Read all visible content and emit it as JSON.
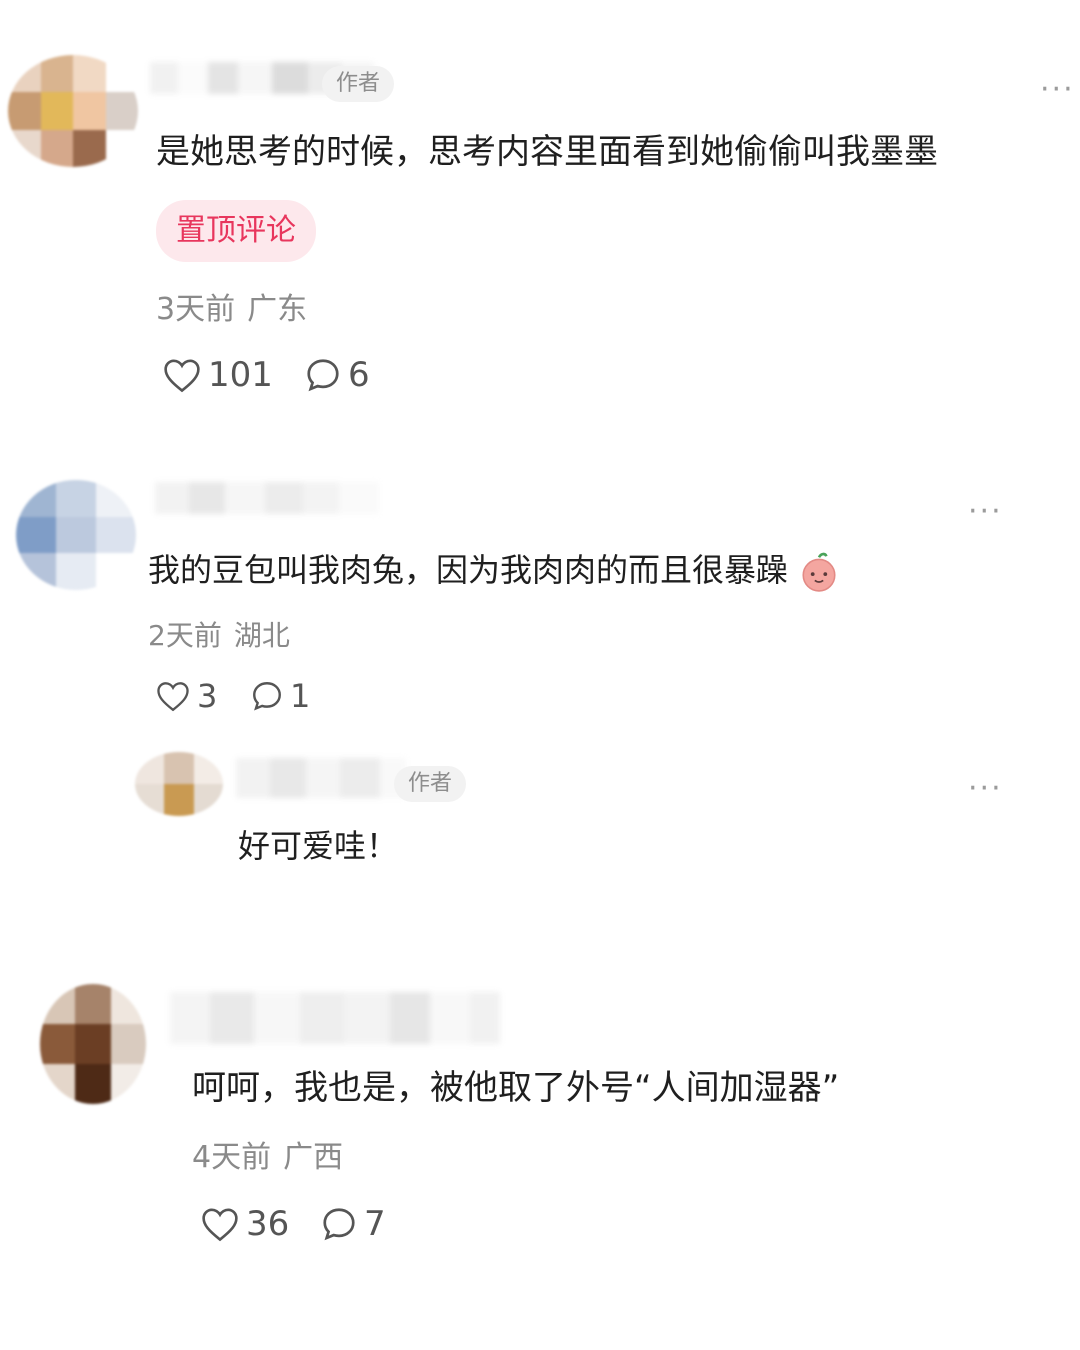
{
  "comments": [
    {
      "author_badge": "作者",
      "text": "是她思考的时候，思考内容里面看到她偷偷叫我墨墨",
      "pinned_label": "置顶评论",
      "time": "3天前",
      "location": "广东",
      "likes": "101",
      "replies": "6"
    },
    {
      "text": "我的豆包叫我肉兔，因为我肉肉的而且很暴躁",
      "time": "2天前",
      "location": "湖北",
      "likes": "3",
      "replies": "1",
      "reply": {
        "author_badge": "作者",
        "text": "好可爱哇！"
      }
    },
    {
      "text": "呵呵，我也是，被他取了外号“人间加湿器”",
      "time": "4天前",
      "location": "广西",
      "likes": "36",
      "replies": "7"
    }
  ],
  "more_icon": "more-horizontal-icon",
  "like_icon": "heart-outline-icon",
  "comment_icon": "speech-bubble-icon",
  "accent_color": "#e8365d"
}
